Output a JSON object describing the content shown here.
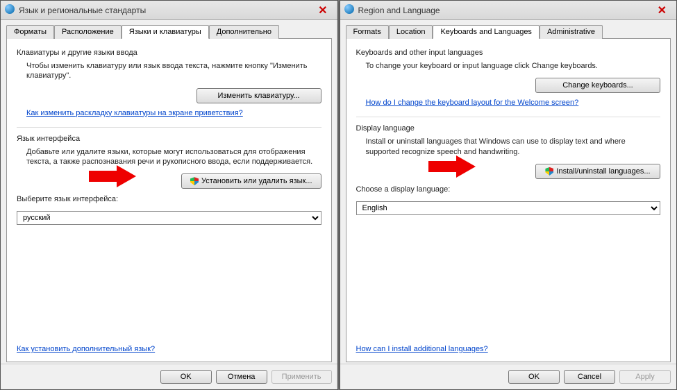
{
  "left": {
    "title": "Язык и региональные стандарты",
    "tabs": [
      "Форматы",
      "Расположение",
      "Языки и клавиатуры",
      "Дополнительно"
    ],
    "active_tab": 2,
    "section1_label": "Клавиатуры и другие языки ввода",
    "section1_text": "Чтобы изменить клавиатуру или язык ввода текста, нажмите кнопку \"Изменить клавиатуру\".",
    "change_kb_btn": "Изменить клавиатуру...",
    "welcome_link": "Как изменить раскладку клавиатуры на экране приветствия?",
    "section2_label": "Язык интерфейса",
    "section2_text": "Добавьте или удалите языки, которые могут использоваться для отображения текста, а также распознавания речи и рукописного ввода, если                         поддерживается.",
    "install_btn": "Установить или удалить язык...",
    "choose_label": "Выберите язык интерфейса:",
    "selected_lang": "русский",
    "bottom_link": "Как установить дополнительный язык?",
    "ok": "OK",
    "cancel": "Отмена",
    "apply": "Применить"
  },
  "right": {
    "title": "Region and Language",
    "tabs": [
      "Formats",
      "Location",
      "Keyboards and Languages",
      "Administrative"
    ],
    "active_tab": 2,
    "section1_label": "Keyboards and other input languages",
    "section1_text": "To change your keyboard or input language click Change keyboards.",
    "change_kb_btn": "Change keyboards...",
    "welcome_link": "How do I change the keyboard layout for the Welcome screen?",
    "section2_label": "Display language",
    "section2_text": "Install or uninstall languages that Windows can use to display text and where supported recognize speech and handwriting.",
    "install_btn": "Install/uninstall languages...",
    "choose_label": "Choose a display language:",
    "selected_lang": "English",
    "bottom_link": "How can I install additional languages?",
    "ok": "OK",
    "cancel": "Cancel",
    "apply": "Apply"
  }
}
